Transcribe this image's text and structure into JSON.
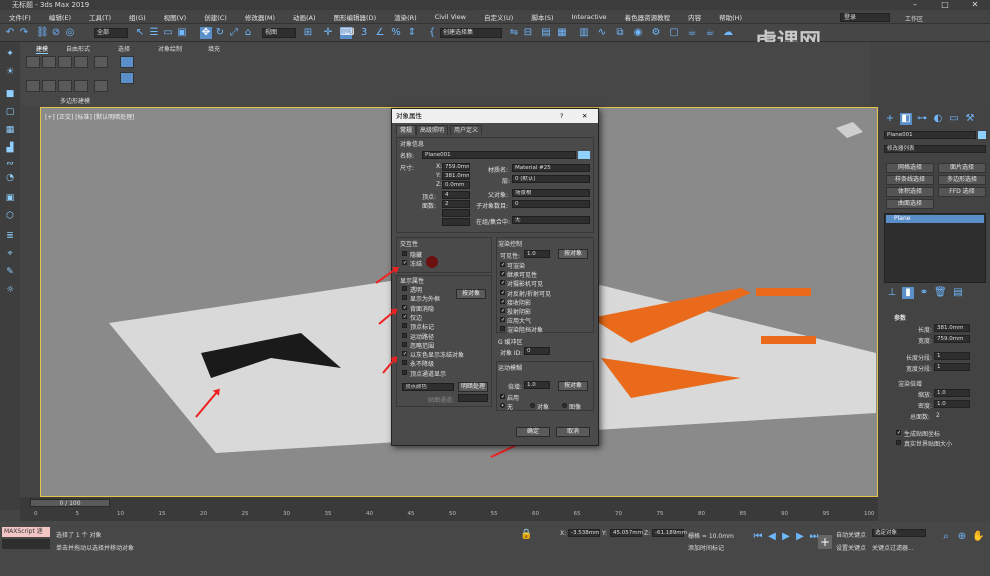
{
  "app": {
    "title": "无标题 - 3ds Max 2019",
    "logo": "虎课网",
    "user_label": "登录",
    "workspace_label": "工作区"
  },
  "menubar": [
    "文件(F)",
    "编辑(E)",
    "工具(T)",
    "组(G)",
    "视图(V)",
    "创建(C)",
    "修改器(M)",
    "动画(A)",
    "图形编辑器(D)",
    "渲染(R)",
    "Civil View",
    "自定义(U)",
    "脚本(S)",
    "Interactive",
    "着色器资源教程",
    "内容",
    "帮助(H)"
  ],
  "toolbar": {
    "filter_value": "全部",
    "refcoord_value": "视图",
    "selset_placeholder": "创建选择集"
  },
  "ribbon": {
    "tabs": [
      "建模",
      "自由形式",
      "选择",
      "对象绘制",
      "填充"
    ],
    "panel_label": "多边形建模"
  },
  "viewport": {
    "label": "[+] [正交] [标准] [默认明暗处理]",
    "colors": {
      "plane": "#d9d9d9",
      "decal": "#e86a1a",
      "shadow": "#1a1a1a"
    }
  },
  "dialog": {
    "title": "对象属性",
    "help": "?",
    "close": "✕",
    "tabs": [
      "常规",
      "高级照明",
      "用户定义"
    ],
    "object_info": {
      "header": "对象信息",
      "name_label": "名称:",
      "name_value": "Plane001",
      "dims_label": "尺寸:",
      "x": "759.0mm",
      "y": "381.0mm",
      "z": "0.0mm",
      "verts_label": "顶点:",
      "verts_value": "4",
      "faces_label": "面数:",
      "faces_value": "2",
      "material_label": "材质名:",
      "material_value": "Material #25",
      "layer_label": "层:",
      "layer_value": "0 (默认)",
      "parent_label": "父对象:",
      "parent_value": "场景根",
      "children_label": "子对象数目:",
      "children_value": "0",
      "group_label": "在组/集合中:",
      "group_value": "无"
    },
    "interactivity": {
      "header": "交互性",
      "hide": "隐藏",
      "freeze": "冻结"
    },
    "display": {
      "header": "显示属性",
      "by_object": "按对象",
      "items": [
        {
          "label": "透明",
          "checked": false
        },
        {
          "label": "显示为外框",
          "checked": false
        },
        {
          "label": "背面消隐",
          "checked": true
        },
        {
          "label": "仅边",
          "checked": true
        },
        {
          "label": "顶点标记",
          "checked": false
        },
        {
          "label": "运动路径",
          "checked": false
        },
        {
          "label": "忽略范围",
          "checked": false
        },
        {
          "label": "以灰色显示冻结对象",
          "checked": true
        },
        {
          "label": "永不降级",
          "checked": false
        },
        {
          "label": "顶点通道显示",
          "checked": false
        }
      ],
      "vertex_color": "顶点颜色",
      "shaded": "明暗处理",
      "map_channel": "贴图通道:"
    },
    "render": {
      "header": "渲染控制",
      "visibility_label": "可见性:",
      "visibility_value": "1.0",
      "by_object": "按对象",
      "items": [
        {
          "label": "可渲染",
          "checked": true
        },
        {
          "label": "继承可见性",
          "checked": true
        },
        {
          "label": "对摄影机可见",
          "checked": true
        },
        {
          "label": "对反射/折射可见",
          "checked": true
        },
        {
          "label": "接收阴影",
          "checked": true
        },
        {
          "label": "投射阴影",
          "checked": true
        },
        {
          "label": "应用大气",
          "checked": true
        },
        {
          "label": "渲染阻挡对象",
          "checked": false
        }
      ],
      "gbuffer_header": "G 缓冲区",
      "object_id_label": "对象 ID:",
      "object_id_value": "0"
    },
    "motion_blur": {
      "header": "运动模糊",
      "multiplier_label": "倍增:",
      "multiplier_value": "1.0",
      "by_object": "按对象",
      "enabled": "启用",
      "none": "无",
      "object": "对象",
      "image": "图像"
    },
    "ok": "确定",
    "cancel": "取消"
  },
  "right_panel": {
    "object_name": "Plane001",
    "modifier_list": "修改器列表",
    "buttons": [
      "网格选择",
      "面片选择",
      "样条线选择",
      "多边形选择",
      "体积选择",
      "FFD 选择",
      "曲面选择"
    ],
    "stack_item": "Plane",
    "params_header": "参数",
    "length_label": "长度:",
    "length_value": "381.0mm",
    "width_label": "宽度:",
    "width_value": "759.0mm",
    "length_segs_label": "长度分段:",
    "length_segs_value": "1",
    "width_segs_label": "宽度分段:",
    "width_segs_value": "1",
    "render_mult_header": "渲染倍增",
    "scale_label": "缩放:",
    "scale_value": "1.0",
    "density_label": "密度:",
    "density_value": "1.0",
    "faces_label": "总面数:",
    "faces_value": "2",
    "gen_map": "生成贴图坐标",
    "real_world": "真实世界贴图大小"
  },
  "timeline": {
    "frame": "0 / 100",
    "ticks": [
      "0",
      "5",
      "10",
      "15",
      "20",
      "25",
      "30",
      "35",
      "40",
      "45",
      "50",
      "55",
      "60",
      "65",
      "70",
      "75",
      "80",
      "85",
      "90",
      "95",
      "100"
    ]
  },
  "status": {
    "maxscript": "MAXScript 迷",
    "selected": "选择了 1 个 对象",
    "hint": "单击并拖动以选择并移动对象",
    "x": "-3.538mm",
    "y": "45.057mm",
    "z": "-61.189mm",
    "grid": "栅格 = 10.0mm",
    "add_time_tag": "添加时间标记",
    "auto_key": "自动关键点",
    "set_key": "设置关键点",
    "selected_obj": "选定对象",
    "key_filters": "关键点过滤器..."
  }
}
